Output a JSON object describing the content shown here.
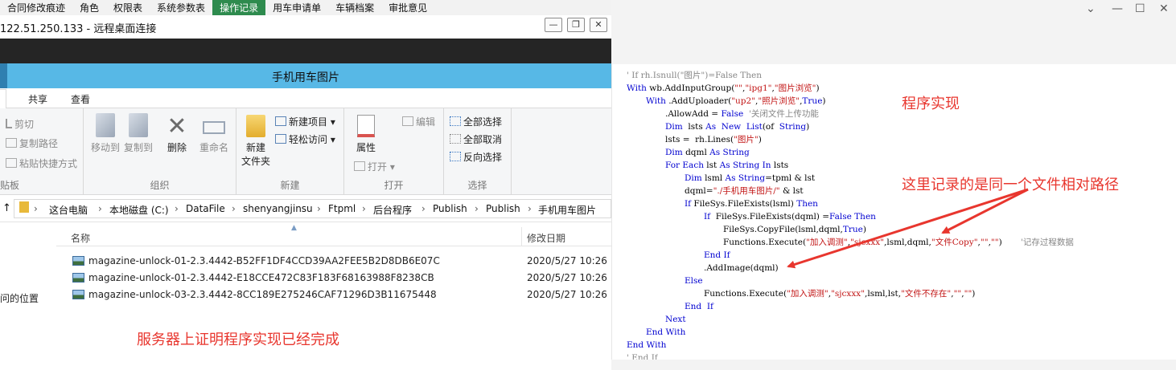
{
  "app_menu": [
    "合同修改痕迹",
    "角色",
    "权限表",
    "系统参数表",
    "操作记录",
    "用车申请单",
    "车辆档案",
    "审批意见"
  ],
  "app_menu_active_index": 4,
  "rdp": {
    "title": "122.51.250.133 - 远程桌面连接",
    "min": "—",
    "restore": "❐",
    "close": "✕"
  },
  "explorer": {
    "title": "手机用车图片",
    "tabs": [
      "共享",
      "查看"
    ],
    "ribbon": {
      "clipboard": {
        "cut": "剪切",
        "copy_path": "复制路径",
        "paste_shortcut": "粘贴快捷方式",
        "group_partial": "贴板"
      },
      "organize": {
        "move_to": "移动到",
        "copy_to": "复制到",
        "delete": "删除",
        "rename": "重命名",
        "group": "组织"
      },
      "new": {
        "new_folder_1": "新建",
        "new_folder_2": "文件夹",
        "new_item": "新建项目 ▾",
        "easy_access": "轻松访问 ▾",
        "group": "新建"
      },
      "open": {
        "properties": "属性",
        "open": "打开 ▾",
        "edit": "编辑",
        "group": "打开"
      },
      "select": {
        "select_all": "全部选择",
        "select_none": "全部取消",
        "invert": "反向选择",
        "group": "选择"
      }
    },
    "breadcrumb": [
      "这台电脑",
      "本地磁盘 (C:)",
      "DataFile",
      "shenyangjinsu",
      "Ftpml",
      "后台程序",
      "Publish",
      "Publish",
      "手机用车图片"
    ],
    "nav_partial": [
      "问的位置"
    ],
    "columns": {
      "name": "名称",
      "modified": "修改日期"
    },
    "files": [
      {
        "name": "magazine-unlock-01-2.3.4442-B52FF1DF4CCD39AA2FEE5B2D8DB6E07C",
        "date": "2020/5/27 10:26"
      },
      {
        "name": "magazine-unlock-01-2.3.4442-E18CCE472C83F183F68163988F8238CB",
        "date": "2020/5/27 10:26"
      },
      {
        "name": "magazine-unlock-03-2.3.4442-8CC189E275246CAF71296D3B11675448",
        "date": "2020/5/27 10:26"
      }
    ],
    "annotation": "服务器上证明程序实现已经完成"
  },
  "editor": {
    "window_buttons": {
      "collapse": "⌄",
      "min": "—",
      "max": "☐",
      "close": "✕"
    },
    "code_lines": [
      "' If rh.Isnull(\"图片\")=False Then",
      "With wb.AddInputGroup(\"\",\"ipg1\",\"图片浏览\")",
      "With .AddUploader(\"up2\",\"照片浏览\",True)",
      ".AllowAdd = False  '关闭文件上传功能",
      "Dim  lsts As  New  List(of  String)",
      "lsts =  rh.Lines(\"图片\")",
      "Dim dqml As String",
      "For Each lst As String In lsts",
      "Dim lsml As String=tpml & lst",
      "dqml=\"./手机用车图片/\" & lst",
      "If FileSys.FileExists(lsml) Then",
      "If  FileSys.FileExists(dqml) =False Then",
      "FileSys.CopyFile(lsml,dqml,True)",
      "Functions.Execute(\"加入调测\",\"sjcxxx\",lsml,dqml,\"文件Copy\",\"\",\"\")       '记存过程数据",
      "End If",
      ".AddImage(dqml)",
      "Else",
      "Functions.Execute(\"加入调测\",\"sjcxxx\",lsml,lst,\"文件不存在\",\"\",\"\")",
      "End  If",
      "Next",
      "End With",
      "End With",
      "' End If"
    ],
    "annotation_1": "程序实现",
    "annotation_2": "这里记录的是同一个文件相对路径"
  },
  "colors": {
    "accent_red": "#e8362e",
    "explorer_title": "#57b8e6",
    "menu_active": "#2e8b4e",
    "keyword_blue": "#0000d0",
    "string_red": "#c21515"
  }
}
